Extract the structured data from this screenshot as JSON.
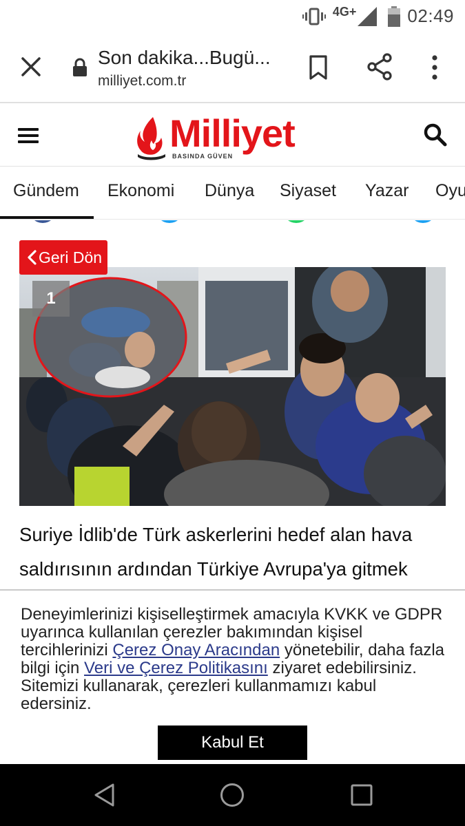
{
  "status_bar": {
    "time": "02:49",
    "network": "4G+",
    "icons": [
      "vibrate-icon",
      "signal-icon",
      "battery-icon"
    ]
  },
  "browser": {
    "tab_title": "Son dakika...Bugü...",
    "url": "milliyet.com.tr",
    "icons": [
      "close-icon",
      "lock-icon",
      "bookmark-icon",
      "share-icon",
      "more-vert-icon"
    ]
  },
  "site": {
    "logo_text": "Milliyet",
    "logo_tagline": "BASINDA GÜVEN",
    "brand_color": "#e3151a",
    "icons": [
      "hamburger-menu-icon",
      "search-icon"
    ]
  },
  "nav": {
    "tabs": [
      {
        "label": "Gündem",
        "active": true
      },
      {
        "label": "Ekonomi",
        "active": false
      },
      {
        "label": "Dünya",
        "active": false
      },
      {
        "label": "Siyaset",
        "active": false
      },
      {
        "label": "Yazar",
        "active": false
      },
      {
        "label": "Oyun",
        "active": false
      }
    ]
  },
  "article": {
    "back_label": "Geri Dön",
    "image_number": "1",
    "headline_line1": "Suriye İdlib'de Türk askerlerini hedef alan hava",
    "headline_line2": "saldırısının ardından Türkiye Avrupa'ya gitmek"
  },
  "cookie": {
    "text_1": "Deneyimlerinizi kişiselleştirmek amacıyla KVKK ve GDPR uyarınca kullanılan çerezler bakımından kişisel tercihlerinizi ",
    "link_1": "Çerez Onay Aracından",
    "text_2": " yönetebilir, daha fazla bilgi için ",
    "link_2": "Veri ve Çerez Politikasını",
    "text_3": " ziyaret edebilirsiniz. Sitemizi kullanarak, çerezleri kullanmamızı kabul edersiniz.",
    "accept_label": "Kabul Et"
  },
  "android_nav": {
    "icons": [
      "back-triangle-icon",
      "home-circle-icon",
      "recents-square-icon"
    ]
  }
}
